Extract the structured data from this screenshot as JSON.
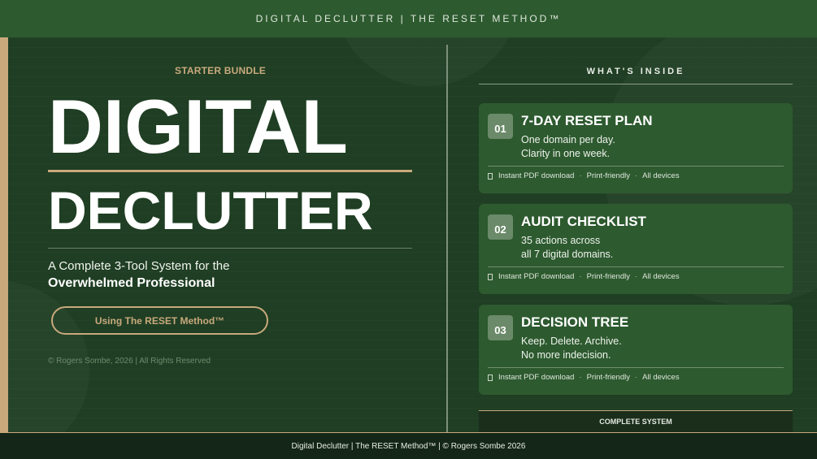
{
  "header": {
    "title": "DIGITAL DECLUTTER  |  THE RESET METHOD™"
  },
  "hero": {
    "bundle_label": "STARTER BUNDLE",
    "title_line1": "DIGITAL",
    "title_line2": "DECLUTTER",
    "subtitle_line1": "A Complete 3-Tool System for the",
    "subtitle_line2": "Overwhelmed Professional",
    "method_button": "Using The RESET Method™",
    "copyright": "© Rogers Sombe, 2026  |  All Rights Reserved"
  },
  "inside": {
    "heading": "WHAT'S INSIDE",
    "meta": {
      "item1": "Instant PDF download",
      "sep": "·",
      "item2": "Print-friendly",
      "item3": "All devices",
      "icon": "document-icon"
    },
    "cards": [
      {
        "number": "01",
        "title": "7-DAY RESET PLAN",
        "desc_line1": "One domain per day.",
        "desc_line2": "Clarity in one week."
      },
      {
        "number": "02",
        "title": "AUDIT CHECKLIST",
        "desc_line1": "35 actions across",
        "desc_line2": "all 7 digital domains."
      },
      {
        "number": "03",
        "title": "DECISION TREE",
        "desc_line1": "Keep. Delete. Archive.",
        "desc_line2": "No more indecision."
      }
    ],
    "complete_label": "COMPLETE SYSTEM"
  },
  "footer": {
    "text": "Digital Declutter  |  The RESET Method™  |  © Rogers Sombe 2026"
  },
  "colors": {
    "background": "#1f3e23",
    "card": "#2d5a2f",
    "accent_gold": "#c8a97c",
    "number_badge": "#6b8a69",
    "footer": "#142617"
  }
}
